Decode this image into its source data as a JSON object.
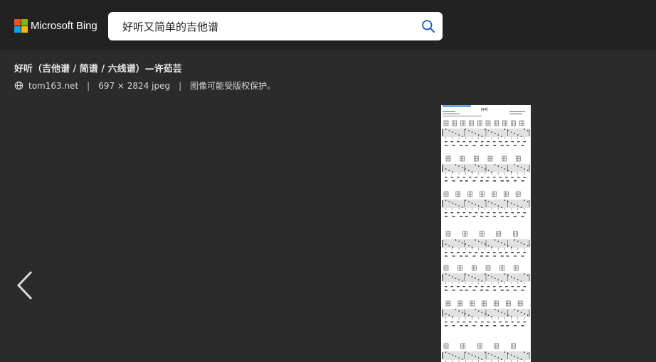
{
  "header": {
    "brand": "Microsoft Bing",
    "logo_colors": [
      "#f25022",
      "#7fba00",
      "#00a4ef",
      "#ffb900"
    ],
    "search_query": "好听又简单的吉他谱",
    "search_icon": "search-icon",
    "search_icon_color": "#1a56c4"
  },
  "result": {
    "title": "好听（吉他谱 / 简谱 / 六线谱）—许茹芸",
    "source": "tom163.net",
    "dimensions": "697 × 2824 jpeg",
    "copyright": "图像可能受版权保护。",
    "separator": "|"
  },
  "image": {
    "sheet_title": "好听"
  },
  "nav": {
    "prev_icon": "chevron-left-icon"
  }
}
